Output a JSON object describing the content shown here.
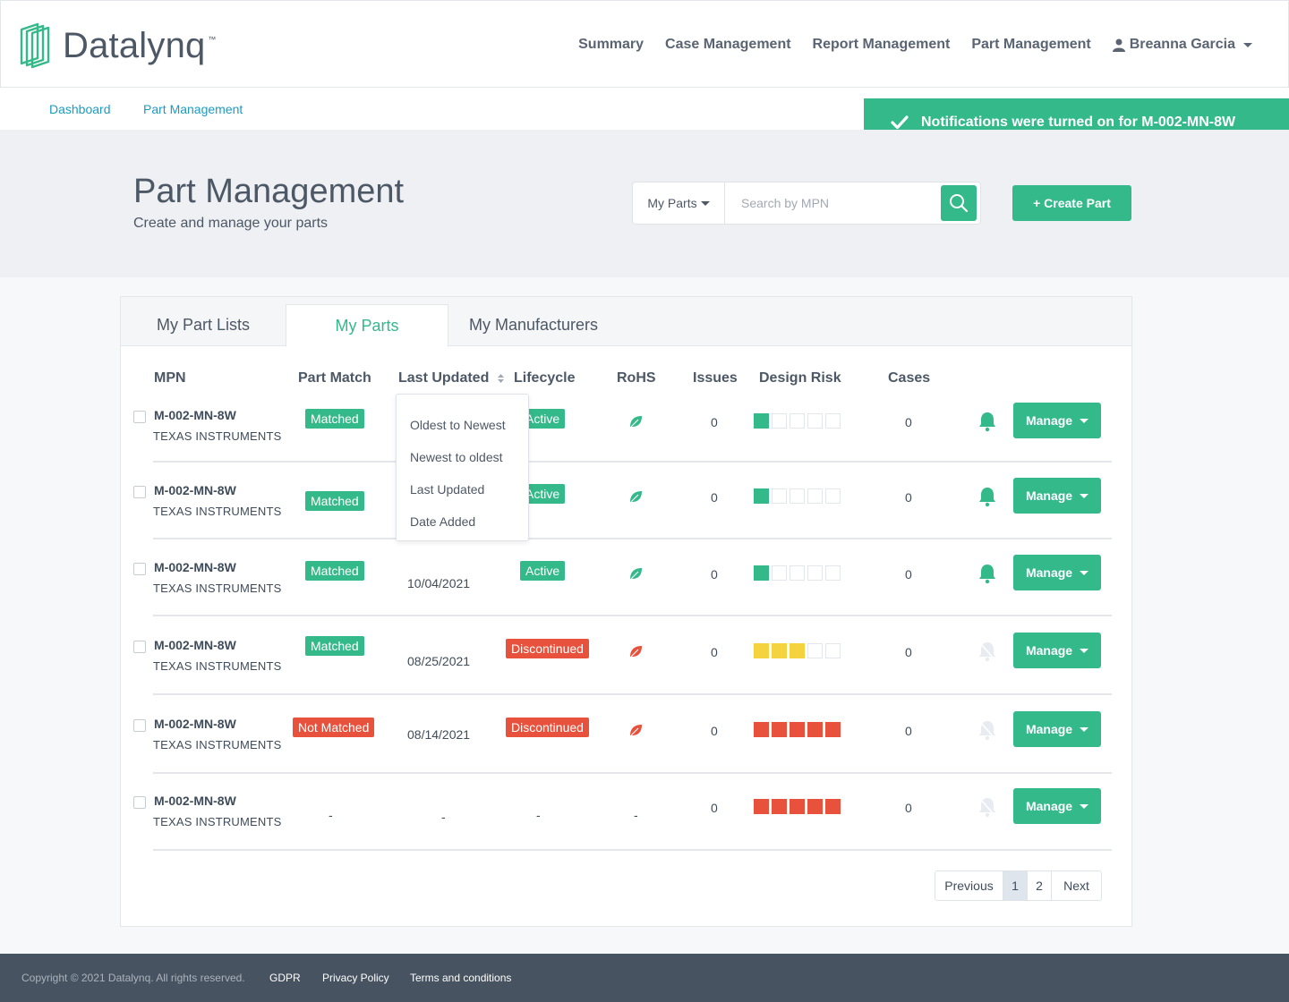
{
  "brand": {
    "name": "Datalynq",
    "tm": "™"
  },
  "nav": {
    "items": [
      "Summary",
      "Case Management",
      "Report Management",
      "Part Management"
    ],
    "user": "Breanna Garcia"
  },
  "breadcrumb": [
    "Dashboard",
    "Part Management"
  ],
  "toast": "Notifications were turned on for M-002-MN-8W",
  "hero": {
    "title": "Part Management",
    "subtitle": "Create and manage your parts",
    "search_scope": "My Parts",
    "search_placeholder": "Search by MPN",
    "create_label": "+ Create Part"
  },
  "tabs": [
    "My Part Lists",
    "My Parts",
    "My Manufacturers"
  ],
  "columns": {
    "mpn": "MPN",
    "part_match": "Part Match",
    "last_updated": "Last Updated",
    "lifecycle": "Lifecycle",
    "rohs": "RoHS",
    "issues": "Issues",
    "design_risk": "Design Risk",
    "cases": "Cases"
  },
  "sort_menu": [
    "Oldest to Newest",
    "Newest to oldest",
    "Last Updated",
    "Date Added"
  ],
  "rows": [
    {
      "mpn": "M-002-MN-8W",
      "mfr": "TEXAS INSTRUMENTS",
      "match": "Matched",
      "updated": "",
      "lifecycle": "Active",
      "rohs": "green",
      "issues": "0",
      "risk": [
        "g",
        "e",
        "e",
        "e",
        "e"
      ],
      "cases": "0",
      "bell": "on",
      "manage": "Manage"
    },
    {
      "mpn": "M-002-MN-8W",
      "mfr": "TEXAS INSTRUMENTS",
      "match": "Matched",
      "updated": "",
      "lifecycle": "Active",
      "rohs": "green",
      "issues": "0",
      "risk": [
        "g",
        "e",
        "e",
        "e",
        "e"
      ],
      "cases": "0",
      "bell": "on",
      "manage": "Manage"
    },
    {
      "mpn": "M-002-MN-8W",
      "mfr": "TEXAS INSTRUMENTS",
      "match": "Matched",
      "updated": "10/04/2021",
      "lifecycle": "Active",
      "rohs": "green",
      "issues": "0",
      "risk": [
        "g",
        "e",
        "e",
        "e",
        "e"
      ],
      "cases": "0",
      "bell": "on",
      "manage": "Manage"
    },
    {
      "mpn": "M-002-MN-8W",
      "mfr": "TEXAS INSTRUMENTS",
      "match": "Matched",
      "updated": "08/25/2021",
      "lifecycle": "Discontinued",
      "rohs": "red",
      "issues": "0",
      "risk": [
        "y",
        "y",
        "y",
        "e",
        "e"
      ],
      "cases": "0",
      "bell": "off",
      "manage": "Manage"
    },
    {
      "mpn": "M-002-MN-8W",
      "mfr": "TEXAS INSTRUMENTS",
      "match": "Not Matched",
      "updated": "08/14/2021",
      "lifecycle": "Discontinued",
      "rohs": "red",
      "issues": "0",
      "risk": [
        "r",
        "r",
        "r",
        "r",
        "r"
      ],
      "cases": "0",
      "bell": "off",
      "manage": "Manage"
    },
    {
      "mpn": "M-002-MN-8W",
      "mfr": "TEXAS INSTRUMENTS",
      "match": "-",
      "updated": "-",
      "lifecycle": "-",
      "rohs": "-",
      "issues": "0",
      "risk": [
        "r",
        "r",
        "r",
        "r",
        "r"
      ],
      "cases": "0",
      "bell": "off",
      "manage": "Manage"
    }
  ],
  "pager": [
    "Previous",
    "1",
    "2",
    "Next"
  ],
  "footer": {
    "copyright": "Copyright © 2021 Datalynq. All rights reserved.",
    "links": [
      "GDPR",
      "Privacy Policy",
      "Terms and conditions"
    ]
  },
  "colors": {
    "accent": "#33b98a",
    "danger": "#e8513c",
    "warning": "#f5d33f",
    "link": "#1a9bc2"
  }
}
